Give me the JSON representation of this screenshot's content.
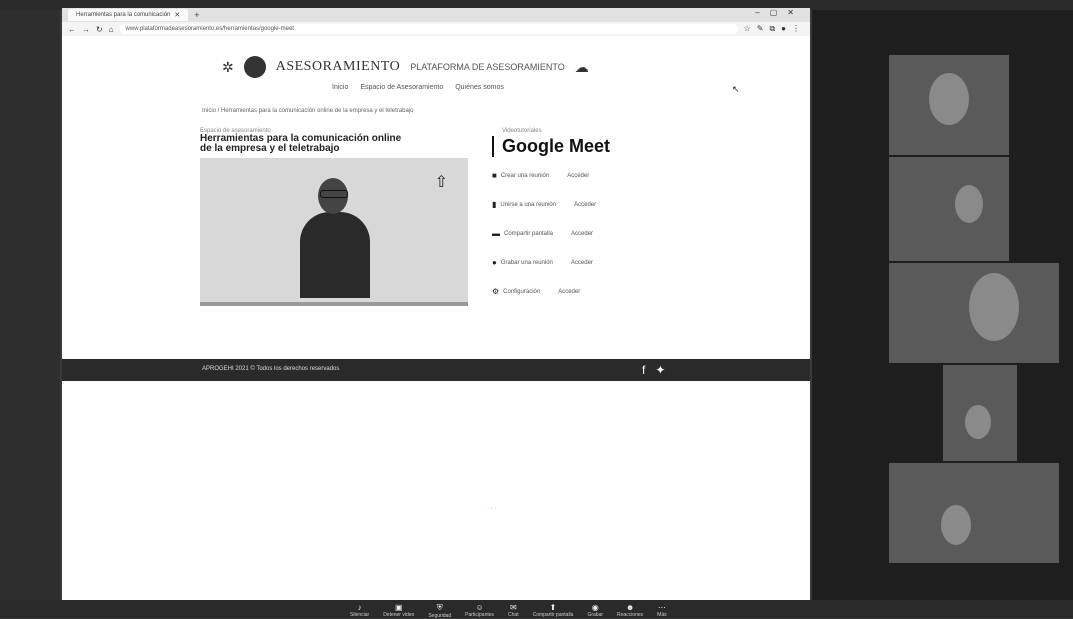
{
  "browser": {
    "tab_title": "Herramientas para la comunicación",
    "url": "www.plataformadeasesoramiento.es/herramientas/google-meet"
  },
  "site": {
    "brand": "ASESORAMIENTO",
    "brand_sub": "PLATAFORMA DE ASESORAMIENTO",
    "menu": [
      "Inicio",
      "Espacio de Asesoramiento",
      "Quiénes somos"
    ],
    "breadcrumb": "Inicio / Herramientas para la comunicación online de la empresa y el teletrabajo"
  },
  "video": {
    "kicker": "Espacio de asesoramiento",
    "title_line1": "Herramientas para la comunicación online",
    "title_line2": "de la empresa y el teletrabajo"
  },
  "google_meet": {
    "kicker": "Videotutoriales",
    "title": "Google Meet",
    "items": [
      {
        "label": "Crear una reunión",
        "action": "Acceder"
      },
      {
        "label": "Unirse a una reunión",
        "action": "Acceder"
      },
      {
        "label": "Compartir pantalla",
        "action": "Acceder"
      },
      {
        "label": "Grabar una reunión",
        "action": "Acceder"
      },
      {
        "label": "Configuración",
        "action": "Acceder"
      }
    ]
  },
  "footer": {
    "text": "APROGEHI 2021 © Todos los derechos reservados"
  },
  "zoom": {
    "controls": [
      "Silenciar",
      "Detener video",
      "Seguridad",
      "Participantes",
      "Chat",
      "Compartir pantalla",
      "Grabar",
      "Reacciones",
      "Más"
    ]
  },
  "colors": {
    "footer_bg": "#2a2a2a",
    "zoom_bg": "#1e1e1e",
    "page_bg": "#ffffff"
  }
}
